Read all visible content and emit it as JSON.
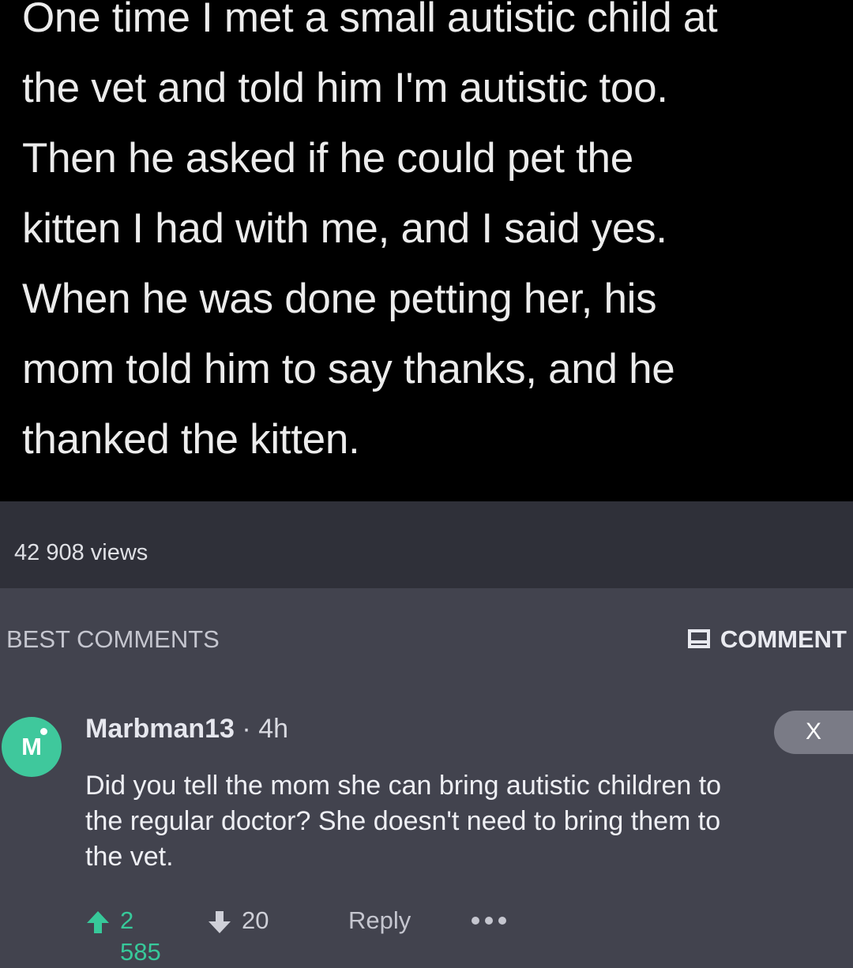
{
  "post": {
    "text": "One time I met a small autistic child at\nthe vet and told him I'm autistic too.\nThen he asked if he could pet the\nkitten I had with me, and I said yes.\nWhen he was done petting her, his\nmom told him to say thanks, and he\nthanked the kitten."
  },
  "stats": {
    "views": "42 908 views"
  },
  "comments_section": {
    "heading": "BEST COMMENTS",
    "comment_button_label": "COMMENT",
    "comment_button_icon": "comment-icon"
  },
  "comment": {
    "avatar_letter": "M",
    "avatar_color": "#3fc89c",
    "username": "Marbman13",
    "separator": "·",
    "time": "4h",
    "close_label": "X",
    "body": "Did you tell the mom she can bring autistic children to\nthe regular doctor?  She doesn't need to bring them to\nthe vet.",
    "upvotes": "2 585",
    "downvotes": "20",
    "reply_label": "Reply",
    "upvote_icon": "upvote-arrow-icon",
    "downvote_icon": "downvote-arrow-icon",
    "more_icon": "more-options-icon",
    "upvote_color": "#37c99a"
  },
  "colors": {
    "post_background": "#000000",
    "views_bar_background": "#2f3039",
    "comments_background": "#42434e"
  }
}
